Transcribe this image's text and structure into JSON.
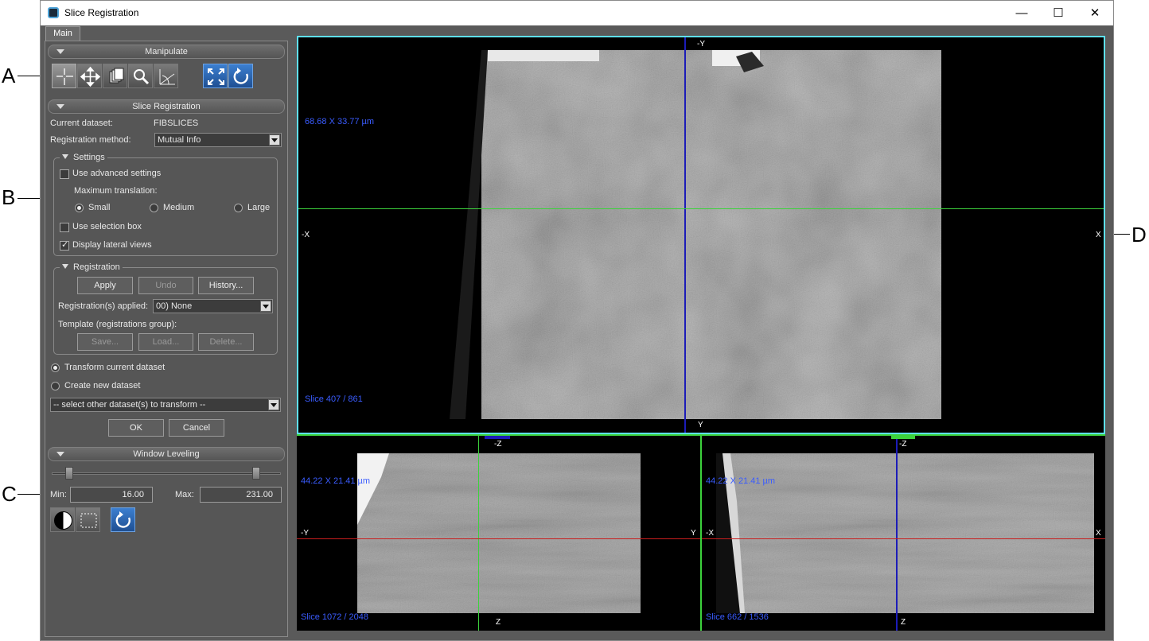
{
  "callouts": {
    "a": "A",
    "b": "B",
    "c": "C",
    "d": "D"
  },
  "window": {
    "title": "Slice Registration",
    "minimize_glyph": "—",
    "maximize_glyph": "☐",
    "close_glyph": "✕"
  },
  "tabs": {
    "main": "Main"
  },
  "manipulate": {
    "header": "Manipulate",
    "tools": [
      "crosshair-icon",
      "move-icon",
      "copy-icon",
      "zoom-icon",
      "rotate-plane-icon",
      "fit-view-icon",
      "reset-view-icon"
    ]
  },
  "slice_registration": {
    "header": "Slice Registration",
    "current_dataset_label": "Current dataset:",
    "current_dataset_value": "FIBSLICES",
    "method_label": "Registration method:",
    "method_value": "Mutual Info",
    "settings": {
      "title": "Settings",
      "advanced_label": "Use advanced settings",
      "advanced_checked": false,
      "max_translation_label": "Maximum translation:",
      "options": [
        "Small",
        "Medium",
        "Large"
      ],
      "selected_option": "Small",
      "selection_box_label": "Use selection box",
      "selection_box_checked": false,
      "lateral_views_label": "Display lateral views",
      "lateral_views_checked": true
    },
    "registration": {
      "title": "Registration",
      "apply": "Apply",
      "undo": "Undo",
      "history": "History...",
      "applied_label": "Registration(s) applied:",
      "applied_value": "00) None",
      "template_label": "Template (registrations group):",
      "save": "Save...",
      "load": "Load...",
      "delete": "Delete..."
    },
    "transform_current": "Transform current dataset",
    "create_new": "Create new dataset",
    "output_selected": "Transform current dataset",
    "other_datasets": "-- select other dataset(s) to transform --",
    "ok": "OK",
    "cancel": "Cancel"
  },
  "window_leveling": {
    "header": "Window Leveling",
    "min_label": "Min:",
    "min_value": "16.00",
    "max_label": "Max:",
    "max_value": "231.00",
    "tools": [
      "contrast-icon",
      "roi-select-icon",
      "reset-icon"
    ]
  },
  "views": {
    "main": {
      "size": "68.68 X 33.77 µm",
      "slice": "Slice 407 / 861",
      "top": "-Y",
      "bottom": "Y",
      "left": "-X",
      "right": "X"
    },
    "left": {
      "size": "44.22 X 21.41 µm",
      "slice": "Slice 1072 / 2048",
      "top": "-Z",
      "bottom": "Z",
      "left": "-Y",
      "right": "Y"
    },
    "right": {
      "size": "44.22 X 21.41 µm",
      "slice": "Slice 662 / 1536",
      "top": "-Z",
      "bottom": "Z",
      "left": "-X",
      "right": "X"
    }
  },
  "colors": {
    "accent_cyan": "#5ee0f0",
    "crosshair_blue": "#1c1cb8",
    "crosshair_green": "#3cd23c",
    "crosshair_red": "#c81e1e",
    "label_blue": "#3a5cff"
  }
}
